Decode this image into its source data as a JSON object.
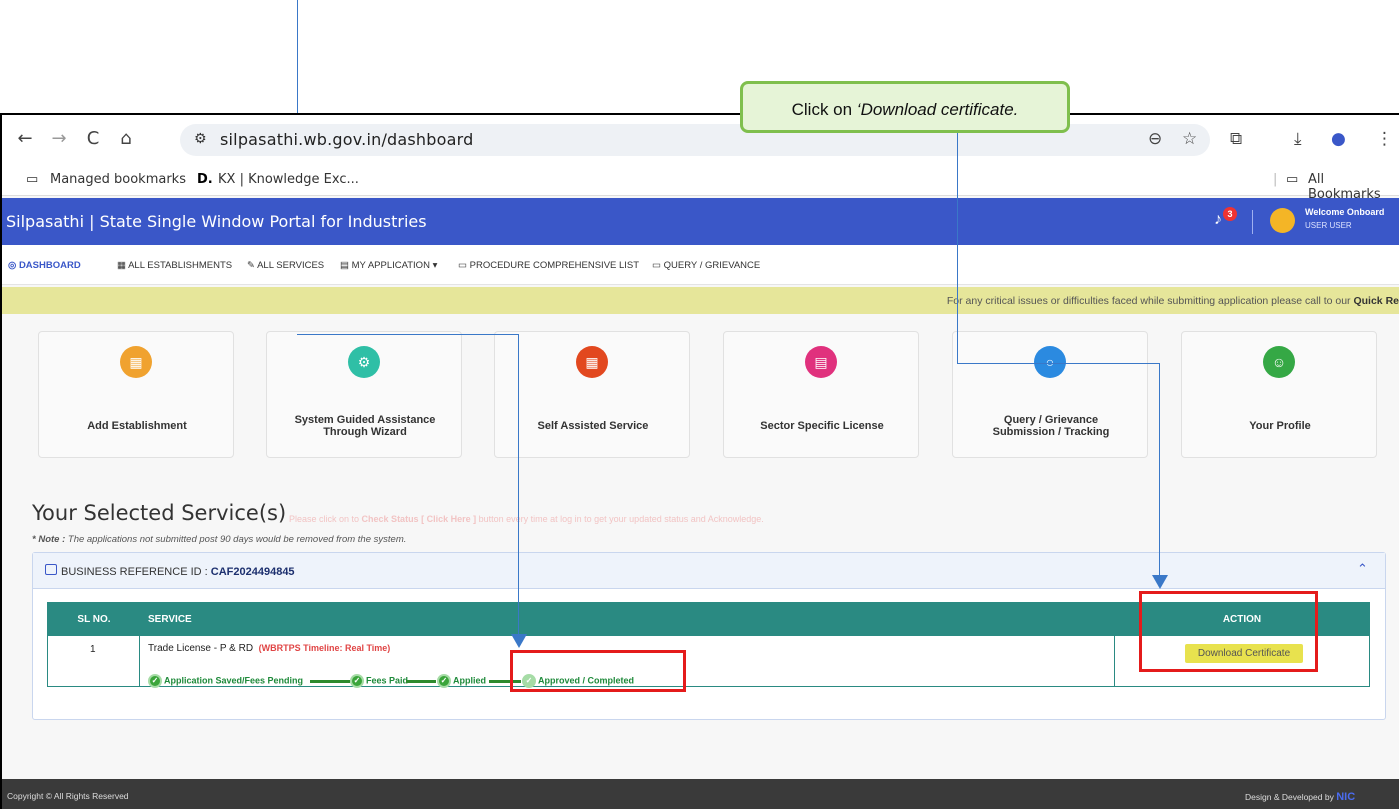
{
  "annotation": {
    "callout_text_prefix": "Click on ",
    "callout_text_em": "‘Download certificate."
  },
  "browser": {
    "url": "silpasathi.wb.gov.in/dashboard",
    "back_icon": "←",
    "forward_icon": "→",
    "reload_icon": "C",
    "home_icon": "⌂",
    "bookmarks": {
      "managed": "Managed bookmarks",
      "kx_prefix": "D.",
      "kx": "KX | Knowledge Exc...",
      "all": "All Bookmarks"
    }
  },
  "site": {
    "title": "Silpasathi | State Single Window Portal for Industries",
    "notif_count": "3",
    "welcome": "Welcome Onboard",
    "user": "USER USER"
  },
  "menu": {
    "dashboard": "DASHBOARD",
    "establishments": "ALL ESTABLISHMENTS",
    "services": "ALL SERVICES",
    "my_application": "MY APPLICATION",
    "procedure": "PROCEDURE COMPREHENSIVE LIST",
    "query": "QUERY / GRIEVANCE"
  },
  "marquee": {
    "text": "For any critical issues or difficulties faced while submitting application please call to our ",
    "bold": "Quick Re"
  },
  "cards": [
    {
      "label": "Add Establishment",
      "color": "#f0a22f"
    },
    {
      "label": "System Guided Assistance Through Wizard",
      "color": "#2fbfa6"
    },
    {
      "label": "Self Assisted Service",
      "color": "#e2481f"
    },
    {
      "label": "Sector Specific License",
      "color": "#e0317d"
    },
    {
      "label": "Query / Grievance Submission / Tracking",
      "color": "#2b8ae0"
    },
    {
      "label": "Your Profile",
      "color": "#35a845"
    }
  ],
  "services": {
    "title": "Your Selected Service(s)",
    "faint_prefix": "Please click on to ",
    "faint_bold": "Check Status [ Click Here ]",
    "faint_suffix": " button every time at log in to get your updated status and Acknowledge.",
    "note_label": "* Note :",
    "note_text": " The applications not submitted post 90 days would be removed from the system.",
    "ref_label": "BUSINESS REFERENCE ID :",
    "ref_id": "CAF2024494845"
  },
  "table": {
    "headers": {
      "sl": "SL NO.",
      "service": "SERVICE",
      "action": "ACTION"
    },
    "row": {
      "sl": "1",
      "service": "Trade License - P & RD",
      "timeline": "(WBRTPS Timeline: Real Time)",
      "steps": [
        "Application Saved/Fees Pending",
        "Fees Paid",
        "Applied",
        "Approved / Completed"
      ],
      "action": "Download Certificate"
    }
  },
  "footer": {
    "left": "Copyright © All Rights Reserved",
    "right": "Design & Developed by",
    "logo": "NIC"
  }
}
